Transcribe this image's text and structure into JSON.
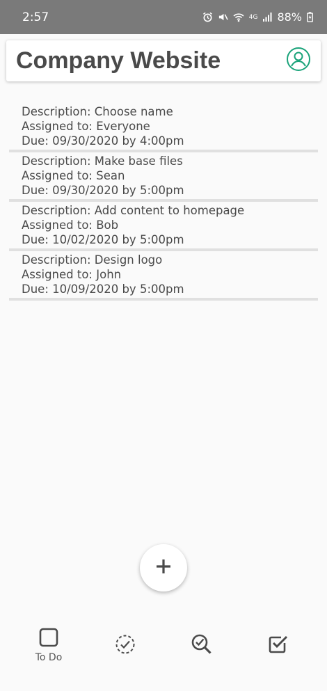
{
  "status_bar": {
    "time": "2:57",
    "network": "4G",
    "battery": "88%"
  },
  "header": {
    "title": "Company Website",
    "profile_icon": "person-circle-icon",
    "accent_color": "#1aa37a"
  },
  "tasks": [
    {
      "description": "Description: Choose name",
      "assigned": "Assigned to: Everyone",
      "due": "Due: 09/30/2020 by 4:00pm"
    },
    {
      "description": "Description: Make base files",
      "assigned": "Assigned to: Sean",
      "due": "Due: 09/30/2020 by 5:00pm"
    },
    {
      "description": "Description: Add content to homepage",
      "assigned": "Assigned to: Bob",
      "due": "Due: 10/02/2020 by 5:00pm"
    },
    {
      "description": "Description: Design logo",
      "assigned": "Assigned to: John",
      "due": "Due: 10/09/2020 by 5:00pm"
    }
  ],
  "fab": {
    "icon": "plus-icon"
  },
  "bottom_nav": {
    "items": [
      {
        "icon": "square-outline-icon",
        "label": "To Do"
      },
      {
        "icon": "dashed-circle-check-icon"
      },
      {
        "icon": "search-check-icon"
      },
      {
        "icon": "checked-box-icon"
      }
    ]
  }
}
